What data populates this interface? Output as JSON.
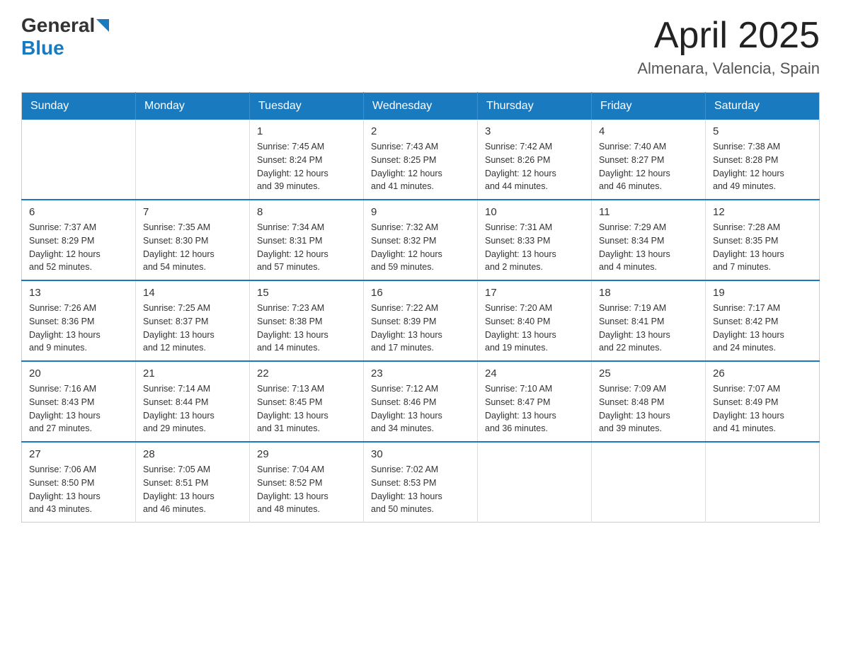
{
  "logo": {
    "general": "General",
    "blue": "Blue"
  },
  "header": {
    "month": "April 2025",
    "location": "Almenara, Valencia, Spain"
  },
  "weekdays": [
    "Sunday",
    "Monday",
    "Tuesday",
    "Wednesday",
    "Thursday",
    "Friday",
    "Saturday"
  ],
  "weeks": [
    [
      {
        "day": "",
        "info": ""
      },
      {
        "day": "",
        "info": ""
      },
      {
        "day": "1",
        "info": "Sunrise: 7:45 AM\nSunset: 8:24 PM\nDaylight: 12 hours\nand 39 minutes."
      },
      {
        "day": "2",
        "info": "Sunrise: 7:43 AM\nSunset: 8:25 PM\nDaylight: 12 hours\nand 41 minutes."
      },
      {
        "day": "3",
        "info": "Sunrise: 7:42 AM\nSunset: 8:26 PM\nDaylight: 12 hours\nand 44 minutes."
      },
      {
        "day": "4",
        "info": "Sunrise: 7:40 AM\nSunset: 8:27 PM\nDaylight: 12 hours\nand 46 minutes."
      },
      {
        "day": "5",
        "info": "Sunrise: 7:38 AM\nSunset: 8:28 PM\nDaylight: 12 hours\nand 49 minutes."
      }
    ],
    [
      {
        "day": "6",
        "info": "Sunrise: 7:37 AM\nSunset: 8:29 PM\nDaylight: 12 hours\nand 52 minutes."
      },
      {
        "day": "7",
        "info": "Sunrise: 7:35 AM\nSunset: 8:30 PM\nDaylight: 12 hours\nand 54 minutes."
      },
      {
        "day": "8",
        "info": "Sunrise: 7:34 AM\nSunset: 8:31 PM\nDaylight: 12 hours\nand 57 minutes."
      },
      {
        "day": "9",
        "info": "Sunrise: 7:32 AM\nSunset: 8:32 PM\nDaylight: 12 hours\nand 59 minutes."
      },
      {
        "day": "10",
        "info": "Sunrise: 7:31 AM\nSunset: 8:33 PM\nDaylight: 13 hours\nand 2 minutes."
      },
      {
        "day": "11",
        "info": "Sunrise: 7:29 AM\nSunset: 8:34 PM\nDaylight: 13 hours\nand 4 minutes."
      },
      {
        "day": "12",
        "info": "Sunrise: 7:28 AM\nSunset: 8:35 PM\nDaylight: 13 hours\nand 7 minutes."
      }
    ],
    [
      {
        "day": "13",
        "info": "Sunrise: 7:26 AM\nSunset: 8:36 PM\nDaylight: 13 hours\nand 9 minutes."
      },
      {
        "day": "14",
        "info": "Sunrise: 7:25 AM\nSunset: 8:37 PM\nDaylight: 13 hours\nand 12 minutes."
      },
      {
        "day": "15",
        "info": "Sunrise: 7:23 AM\nSunset: 8:38 PM\nDaylight: 13 hours\nand 14 minutes."
      },
      {
        "day": "16",
        "info": "Sunrise: 7:22 AM\nSunset: 8:39 PM\nDaylight: 13 hours\nand 17 minutes."
      },
      {
        "day": "17",
        "info": "Sunrise: 7:20 AM\nSunset: 8:40 PM\nDaylight: 13 hours\nand 19 minutes."
      },
      {
        "day": "18",
        "info": "Sunrise: 7:19 AM\nSunset: 8:41 PM\nDaylight: 13 hours\nand 22 minutes."
      },
      {
        "day": "19",
        "info": "Sunrise: 7:17 AM\nSunset: 8:42 PM\nDaylight: 13 hours\nand 24 minutes."
      }
    ],
    [
      {
        "day": "20",
        "info": "Sunrise: 7:16 AM\nSunset: 8:43 PM\nDaylight: 13 hours\nand 27 minutes."
      },
      {
        "day": "21",
        "info": "Sunrise: 7:14 AM\nSunset: 8:44 PM\nDaylight: 13 hours\nand 29 minutes."
      },
      {
        "day": "22",
        "info": "Sunrise: 7:13 AM\nSunset: 8:45 PM\nDaylight: 13 hours\nand 31 minutes."
      },
      {
        "day": "23",
        "info": "Sunrise: 7:12 AM\nSunset: 8:46 PM\nDaylight: 13 hours\nand 34 minutes."
      },
      {
        "day": "24",
        "info": "Sunrise: 7:10 AM\nSunset: 8:47 PM\nDaylight: 13 hours\nand 36 minutes."
      },
      {
        "day": "25",
        "info": "Sunrise: 7:09 AM\nSunset: 8:48 PM\nDaylight: 13 hours\nand 39 minutes."
      },
      {
        "day": "26",
        "info": "Sunrise: 7:07 AM\nSunset: 8:49 PM\nDaylight: 13 hours\nand 41 minutes."
      }
    ],
    [
      {
        "day": "27",
        "info": "Sunrise: 7:06 AM\nSunset: 8:50 PM\nDaylight: 13 hours\nand 43 minutes."
      },
      {
        "day": "28",
        "info": "Sunrise: 7:05 AM\nSunset: 8:51 PM\nDaylight: 13 hours\nand 46 minutes."
      },
      {
        "day": "29",
        "info": "Sunrise: 7:04 AM\nSunset: 8:52 PM\nDaylight: 13 hours\nand 48 minutes."
      },
      {
        "day": "30",
        "info": "Sunrise: 7:02 AM\nSunset: 8:53 PM\nDaylight: 13 hours\nand 50 minutes."
      },
      {
        "day": "",
        "info": ""
      },
      {
        "day": "",
        "info": ""
      },
      {
        "day": "",
        "info": ""
      }
    ]
  ]
}
